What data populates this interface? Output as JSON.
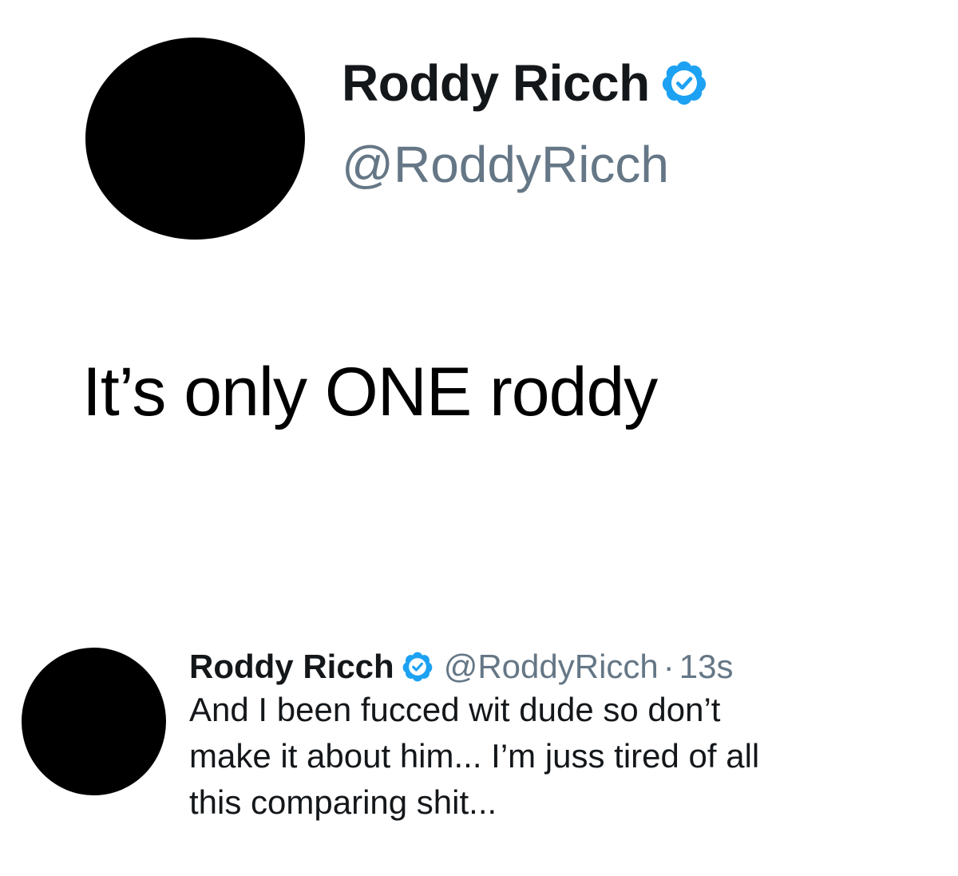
{
  "tweet_large": {
    "display_name": "Roddy Ricch",
    "handle": "@RoddyRicch",
    "verified_icon": "verified-badge-icon",
    "text": "It’s only ONE roddy"
  },
  "tweet_small": {
    "display_name": "Roddy Ricch",
    "handle": "@RoddyRicch",
    "separator": "·",
    "timestamp": "13s",
    "verified_icon": "verified-badge-icon",
    "text_lines": [
      "And I been fucced wit dude so don’t",
      "make it about him... I’m juss tired of all",
      "this comparing shit..."
    ]
  },
  "colors": {
    "verified_blue": "#1da1f2",
    "secondary_text": "#657786",
    "primary_text": "#14171a"
  }
}
